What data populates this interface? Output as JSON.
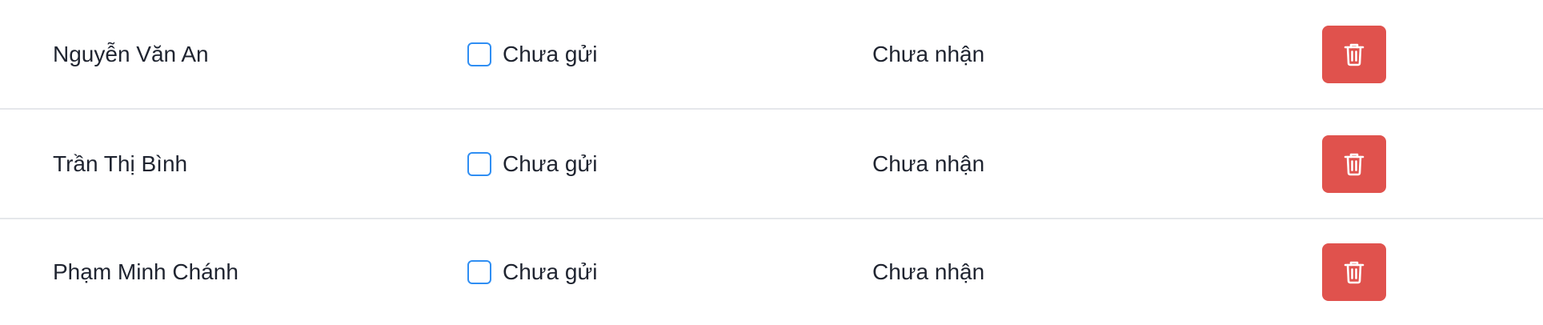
{
  "rows": [
    {
      "name": "Nguyễn Văn An",
      "sent_checked": false,
      "sent_label": "Chưa gửi",
      "received_label": "Chưa nhận",
      "delete_icon": "trash-icon"
    },
    {
      "name": "Trần Thị Bình",
      "sent_checked": false,
      "sent_label": "Chưa gửi",
      "received_label": "Chưa nhận",
      "delete_icon": "trash-icon"
    },
    {
      "name": "Phạm Minh Chánh",
      "sent_checked": false,
      "sent_label": "Chưa gửi",
      "received_label": "Chưa nhận",
      "delete_icon": "trash-icon"
    }
  ],
  "colors": {
    "delete_button": "#e0524d",
    "checkbox_border": "#2f8ef3",
    "divider": "#e5e7eb",
    "text": "#1f2430"
  }
}
